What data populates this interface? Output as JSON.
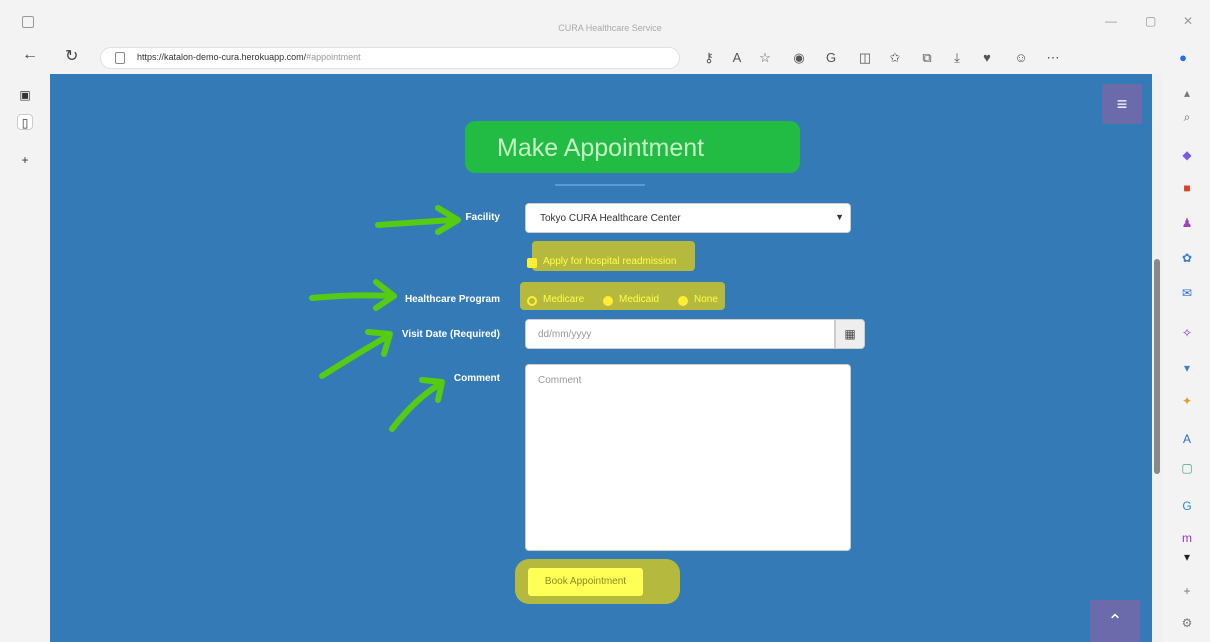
{
  "browser": {
    "tab_title": "CURA Healthcare Service",
    "url_main": "https://katalon-demo-cura.herokuapp.com/",
    "url_hash": "#appointment",
    "minimize": "—",
    "restore": "▢",
    "close": "✕"
  },
  "page": {
    "title": "Make Appointment",
    "facility": {
      "label": "Facility",
      "value": "Tokyo CURA Healthcare Center"
    },
    "readmission": {
      "label": "Apply for hospital readmission"
    },
    "program": {
      "label": "Healthcare Program",
      "options": [
        "Medicare",
        "Medicaid",
        "None"
      ]
    },
    "visit_date": {
      "label": "Visit Date (Required)",
      "placeholder": "dd/mm/yyyy"
    },
    "comment": {
      "label": "Comment",
      "placeholder": "Comment"
    },
    "book_button": "Book Appointment"
  },
  "annotations": {
    "arrow_color": "#55cc11",
    "highlight_green": "#22bb44",
    "highlight_yellow": "#b5b93e"
  }
}
